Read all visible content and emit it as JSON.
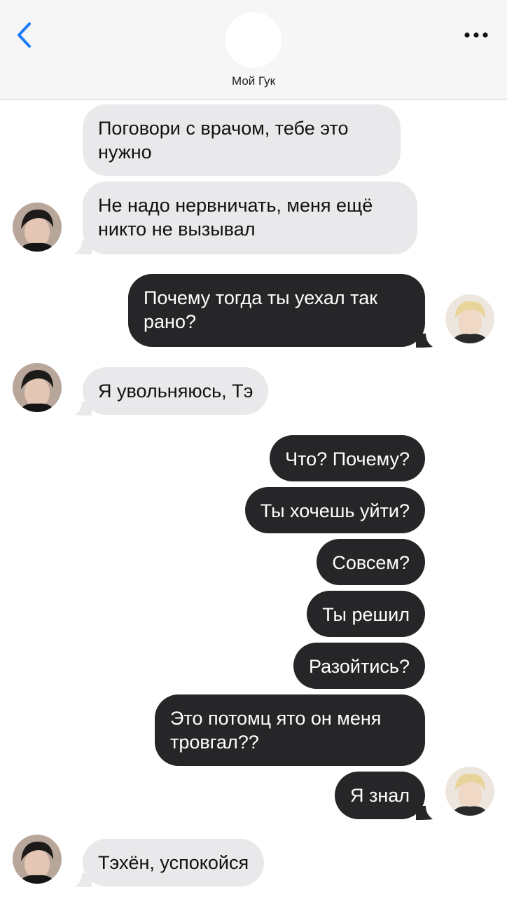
{
  "header": {
    "contact_name": "Мой Гук",
    "back_icon": "chevron-left-icon",
    "more_icon": "ellipsis-icon",
    "accent_color": "#1a7cf5"
  },
  "colors": {
    "incoming_bubble": "#e9e9eb",
    "outgoing_bubble": "#262628",
    "header_background": "#f6f6f7"
  },
  "messages": [
    {
      "direction": "incoming",
      "text": "Поговори с врачом, тебе это нужно"
    },
    {
      "direction": "incoming",
      "text": "Не надо нервничать, меня ещё никто не вызывал"
    },
    {
      "direction": "outgoing",
      "text": "Почему тогда ты уехал так рано?"
    },
    {
      "direction": "incoming",
      "text": "Я увольняюсь, Тэ"
    },
    {
      "direction": "outgoing",
      "text": "Что? Почему?"
    },
    {
      "direction": "outgoing",
      "text": "Ты хочешь уйти?"
    },
    {
      "direction": "outgoing",
      "text": "Совсем?"
    },
    {
      "direction": "outgoing",
      "text": "Ты решил"
    },
    {
      "direction": "outgoing",
      "text": "Разойтись?"
    },
    {
      "direction": "outgoing",
      "text": "Это потомц ято он меня тровгал??"
    },
    {
      "direction": "outgoing",
      "text": "Я знал"
    },
    {
      "direction": "incoming",
      "text": "Тэхён, успокойся"
    }
  ]
}
